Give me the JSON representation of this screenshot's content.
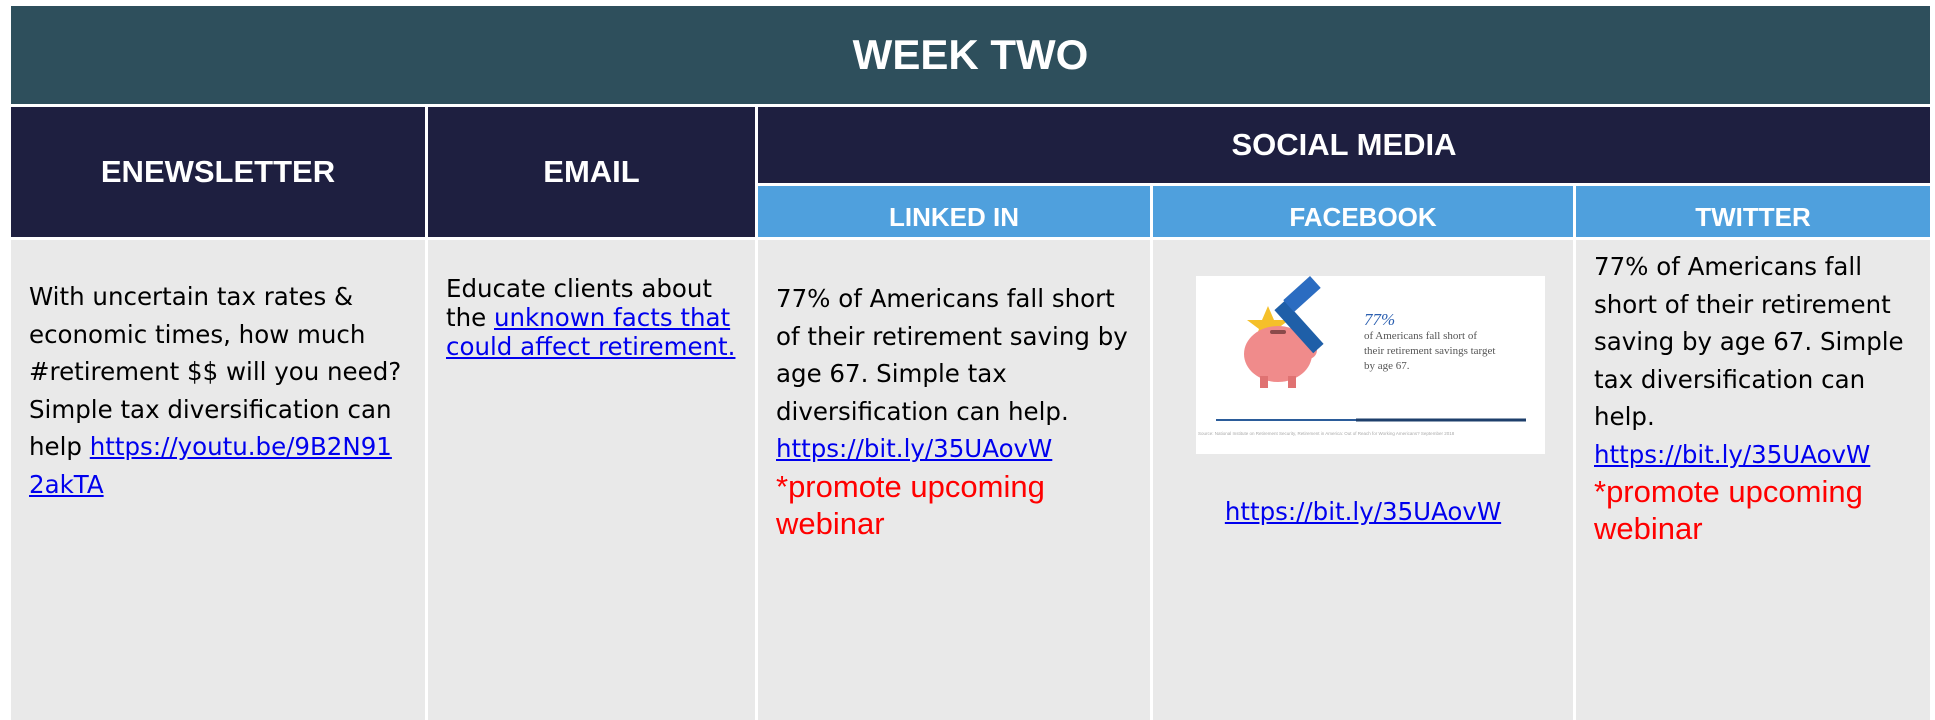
{
  "title": "WEEK TWO",
  "headers": {
    "enewsletter": "ENEWSLETTER",
    "email": "EMAIL",
    "social_media": "SOCIAL MEDIA",
    "linkedin": "LINKED IN",
    "facebook": "FACEBOOK",
    "twitter": "TWITTER"
  },
  "enewsletter": {
    "text": "With uncertain tax rates & economic times, how much #retirement $$ will you need?  Simple tax diversification can help",
    "link": "https://youtu.be/9B2N912akTA"
  },
  "email": {
    "prefix": "Educate clients about the ",
    "link": "unknown facts that could affect retirement."
  },
  "linkedin": {
    "text": "77% of Americans fall short of their retirement saving by age 67. Simple tax diversification can help.",
    "link": "https://bit.ly/35UAovW",
    "note": "*promote upcoming webinar"
  },
  "facebook": {
    "image": {
      "stat": "77%",
      "caption": "of Americans fall short of their retirement savings target by age 67.",
      "source": "Source: National Institute on Retirement Security, Retirement in America: Out of Reach for Working Americans? September 2018"
    },
    "link": "https://bit.ly/35UAovW"
  },
  "twitter": {
    "text": "77% of Americans fall short of their retirement saving by age 67. Simple tax diversification can help.",
    "link": "https://bit.ly/35UAovW",
    "note": "*promote upcoming webinar"
  },
  "colors": {
    "title_bg": "#2e4f5c",
    "header_bg": "#1e1f40",
    "subheader_bg": "#4fa0dd",
    "cell_bg": "#e9e9e9",
    "link": "#0000ee",
    "note": "#ff0000"
  }
}
